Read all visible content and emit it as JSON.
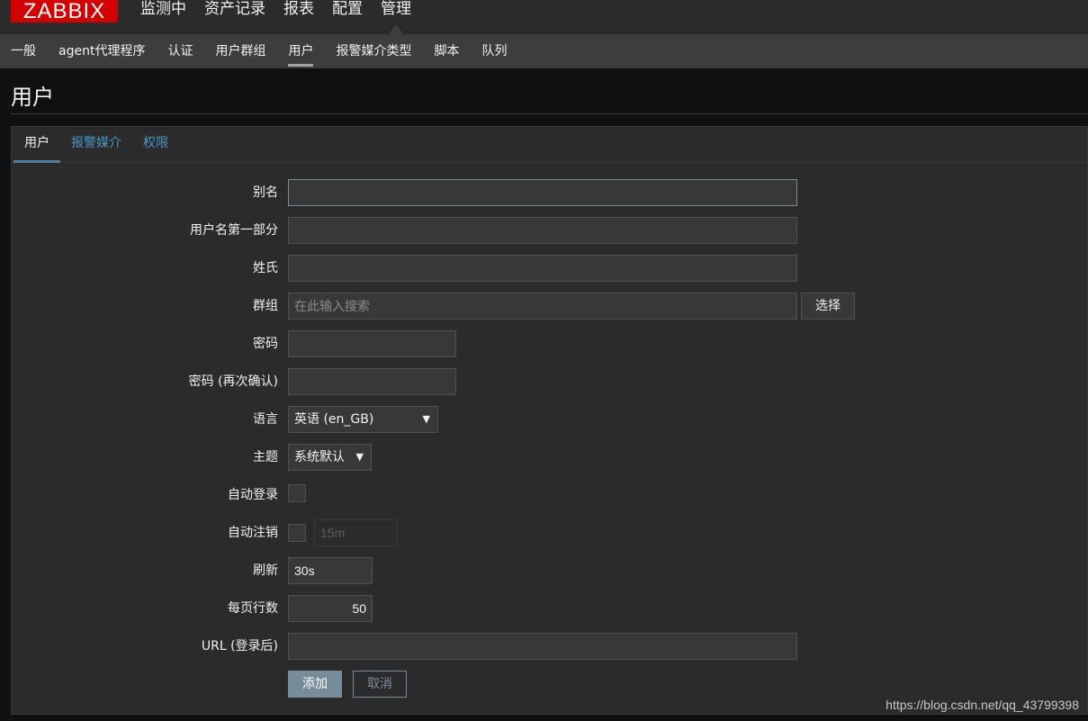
{
  "logo": {
    "text": "ZABBIX"
  },
  "main_menu": [
    "监测中",
    "资产记录",
    "报表",
    "配置",
    "管理"
  ],
  "sub_menu": [
    "一般",
    "agent代理程序",
    "认证",
    "用户群组",
    "用户",
    "报警媒介类型",
    "脚本",
    "队列"
  ],
  "page_title": "用户",
  "tabs": [
    "用户",
    "报警媒介",
    "权限"
  ],
  "form": {
    "alias": {
      "label": "别名",
      "value": ""
    },
    "name": {
      "label": "用户名第一部分",
      "value": ""
    },
    "surname": {
      "label": "姓氏",
      "value": ""
    },
    "groups": {
      "label": "群组",
      "placeholder": "在此输入搜索",
      "button": "选择"
    },
    "password": {
      "label": "密码",
      "value": ""
    },
    "password_confirm": {
      "label": "密码 (再次确认)",
      "value": ""
    },
    "language": {
      "label": "语言",
      "value": "英语 (en_GB)"
    },
    "theme": {
      "label": "主题",
      "value": "系统默认"
    },
    "autologin": {
      "label": "自动登录",
      "checked": false
    },
    "autologout": {
      "label": "自动注销",
      "checked": false,
      "value": "15m"
    },
    "refresh": {
      "label": "刷新",
      "value": "30s"
    },
    "rows_per_page": {
      "label": "每页行数",
      "value": "50"
    },
    "url": {
      "label": "URL (登录后)",
      "value": ""
    },
    "add_button": "添加",
    "cancel_button": "取消"
  },
  "watermark": "https://blog.csdn.net/qq_43799398",
  "colors": {
    "accent": "#768d99",
    "link": "#4796c4",
    "logo": "#d40000"
  }
}
